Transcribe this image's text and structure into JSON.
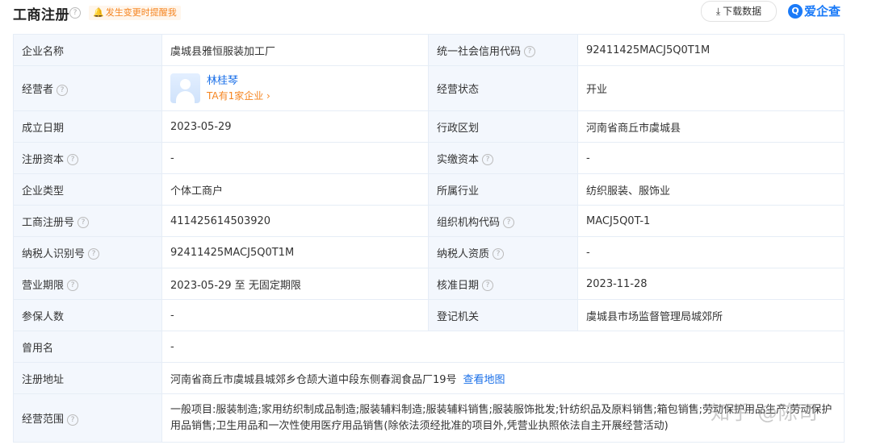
{
  "header": {
    "title": "工商注册",
    "remind_label": "发生变更时提醒我",
    "download_label": "下载数据",
    "logo_mark": "Q",
    "logo_text": "爱企查"
  },
  "rows": {
    "company_name": {
      "label": "企业名称",
      "value": "虞城县雅恒服装加工厂"
    },
    "credit_code": {
      "label": "统一社会信用代码",
      "value": "92411425MACJ5Q0T1M"
    },
    "operator": {
      "label": "经营者",
      "name": "林桂琴",
      "sub": "TA有1家企业 ›"
    },
    "status": {
      "label": "经营状态",
      "value": "开业"
    },
    "established": {
      "label": "成立日期",
      "value": "2023-05-29"
    },
    "region": {
      "label": "行政区划",
      "value": "河南省商丘市虞城县"
    },
    "reg_capital": {
      "label": "注册资本",
      "value": "-"
    },
    "paid_capital": {
      "label": "实缴资本",
      "value": "-"
    },
    "company_type": {
      "label": "企业类型",
      "value": "个体工商户"
    },
    "industry": {
      "label": "所属行业",
      "value": "纺织服装、服饰业"
    },
    "reg_number": {
      "label": "工商注册号",
      "value": "411425614503920"
    },
    "org_code": {
      "label": "组织机构代码",
      "value": "MACJ5Q0T-1"
    },
    "taxpayer_id": {
      "label": "纳税人识别号",
      "value": "92411425MACJ5Q0T1M"
    },
    "taxpayer_qual": {
      "label": "纳税人资质",
      "value": "-"
    },
    "business_term": {
      "label": "营业期限",
      "value": "2023-05-29 至 无固定期限"
    },
    "approval_date": {
      "label": "核准日期",
      "value": "2023-11-28"
    },
    "insured": {
      "label": "参保人数",
      "value": "-"
    },
    "authority": {
      "label": "登记机关",
      "value": "虞城县市场监督管理局城郊所"
    },
    "former_name": {
      "label": "曾用名",
      "value": "-"
    },
    "address": {
      "label": "注册地址",
      "value": "河南省商丘市虞城县城郊乡仓颉大道中段东侧春润食品厂19号",
      "link": "查看地图"
    },
    "scope": {
      "label": "经营范围",
      "value": "一般项目:服装制造;家用纺织制成品制造;服装辅料制造;服装辅料销售;服装服饰批发;针纺织品及原料销售;箱包销售;劳动保护用品生产;劳动保护用品销售;卫生用品和一次性使用医疗用品销售(除依法须经批准的项目外,凭营业执照依法自主开展经营活动)"
    }
  },
  "help_glyph": "?",
  "watermark": "知乎 @陈司",
  "colors": {
    "accent": "#1a6fe8",
    "orange": "#f5841f",
    "label_bg": "#f3f7fd",
    "border": "#e6edf6"
  }
}
